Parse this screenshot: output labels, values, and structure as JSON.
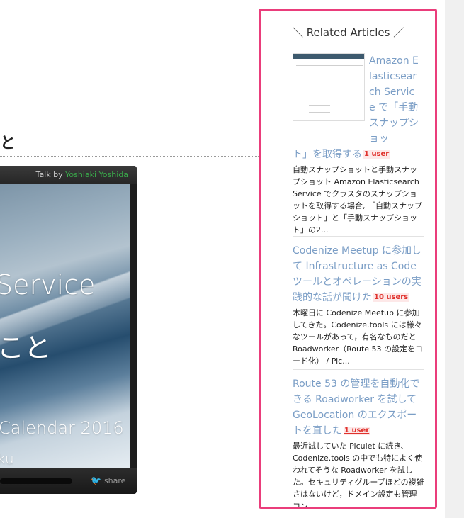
{
  "main": {
    "heading_fragment": "と",
    "embed": {
      "talk_by_label": "Talk by",
      "author": "Yoshiaki Yoshida",
      "slide_line1": "Service",
      "slide_line2": "こと",
      "slide_line3": "Calendar 2016",
      "slide_line4": "ku",
      "share_label": "share"
    }
  },
  "sidebar": {
    "title": "＼ Related Articles ／",
    "accent_color": "#ea3d7b",
    "link_color": "#7b9ec6",
    "articles": [
      {
        "title": "Amazon Elasticsearch Service で「手動スナップショット」を取得する",
        "title_top": "Amazon Elasticsearch Service で「手動スナップショッ",
        "title_bottom": "ト」を取得する",
        "users": "1 user",
        "excerpt": "自動スナップショットと手動スナップショット Amazon Elasticsearch Service でクラスタのスナップショットを取得する場合, 「自動スナップショット」と「手動スナップショット」の2..."
      },
      {
        "title": "Codenize Meetup に参加して Infrastructure as Code ツールとオペレーションの実践的な話が聞けた",
        "users": "10 users",
        "excerpt": "木曜日に Codenize Meetup に参加してきた。Codenize.tools には様々なツールがあって，有名なものだと Roadworker（Route 53 の設定をコード化） / Pic..."
      },
      {
        "title": "Route 53 の管理を自動化できる Roadworker を試して GeoLocation のエクスポートを直した",
        "users": "1 user",
        "excerpt": "最近試していた Piculet に続き、Codenize.tools の中でも特によく使われてそうな Roadworker を試した。セキュリティグループほどの複雑さはないけど，ドメイン設定も管理コン..."
      }
    ]
  }
}
